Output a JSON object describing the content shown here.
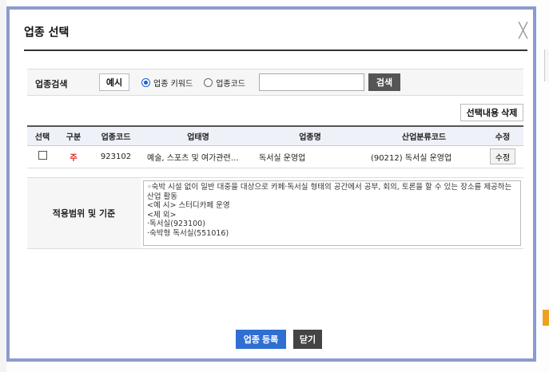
{
  "modal": {
    "title": "업종 선택",
    "close_glyph": "╳"
  },
  "search": {
    "label": "업종검색",
    "example_button": "예시",
    "radio_keyword": "업종 키워드",
    "radio_code": "업종코드",
    "input_value": "",
    "search_button": "검색"
  },
  "actions": {
    "delete_selected": "선택내용 삭제"
  },
  "table": {
    "headers": [
      "선택",
      "구분",
      "업종코드",
      "업태명",
      "업종명",
      "산업분류코드",
      "수정"
    ],
    "rows": [
      {
        "type": "주",
        "code": "923102",
        "business_type": "예술, 스포츠 및 여가관련…",
        "industry_name": "독서실 운영업",
        "class_code": "(90212) 독서실 운영업",
        "edit": "수정"
      }
    ]
  },
  "scope": {
    "label": "적용범위 및 기준",
    "text": "◦숙박 시설 없이 일반 대중을 대상으로 카페·독서실 형태의 공간에서 공부, 회의, 토론을 할 수 있는 장소를 제공하는 산업 활동\n<예 시> 스터디카페 운영\n<제 외>\n·독서실(923100)\n·숙박형 독서실(551016)"
  },
  "footer": {
    "register_button": "업종 등록",
    "close_button": "닫기"
  },
  "colors": {
    "accent": "#2f6fd1",
    "modal_border": "#8a9bd0",
    "main_mark": "#dd2222"
  }
}
